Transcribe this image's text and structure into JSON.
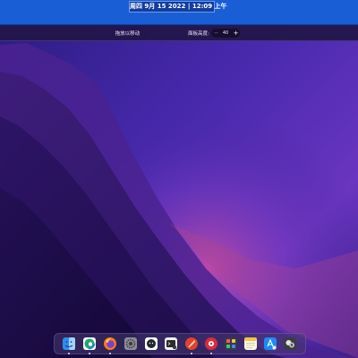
{
  "topbar": {
    "clock": "周四 9月 15 2022 | 12:09 上午"
  },
  "panel_settings": {
    "drag_hint": "拖放以移动",
    "panel_height_label": "面板高度:",
    "panel_height_value": "40",
    "minus_symbol": "−",
    "plus_symbol": "+"
  },
  "dock": {
    "items": [
      {
        "name": "finder",
        "running": true
      },
      {
        "name": "edge-browser",
        "running": true
      },
      {
        "name": "firefox",
        "running": true
      },
      {
        "name": "system-settings",
        "running": false
      },
      {
        "name": "github",
        "running": false
      },
      {
        "name": "terminal",
        "running": false
      },
      {
        "name": "app-a",
        "running": true
      },
      {
        "name": "app-b",
        "running": true
      },
      {
        "name": "launchpad",
        "running": false
      },
      {
        "name": "notes",
        "running": false
      },
      {
        "name": "app-store",
        "running": false
      },
      {
        "name": "app-c",
        "running": false
      }
    ]
  },
  "colors": {
    "topbar": "#1a5ed6",
    "wallpaper_accent": "#c24a9b"
  }
}
